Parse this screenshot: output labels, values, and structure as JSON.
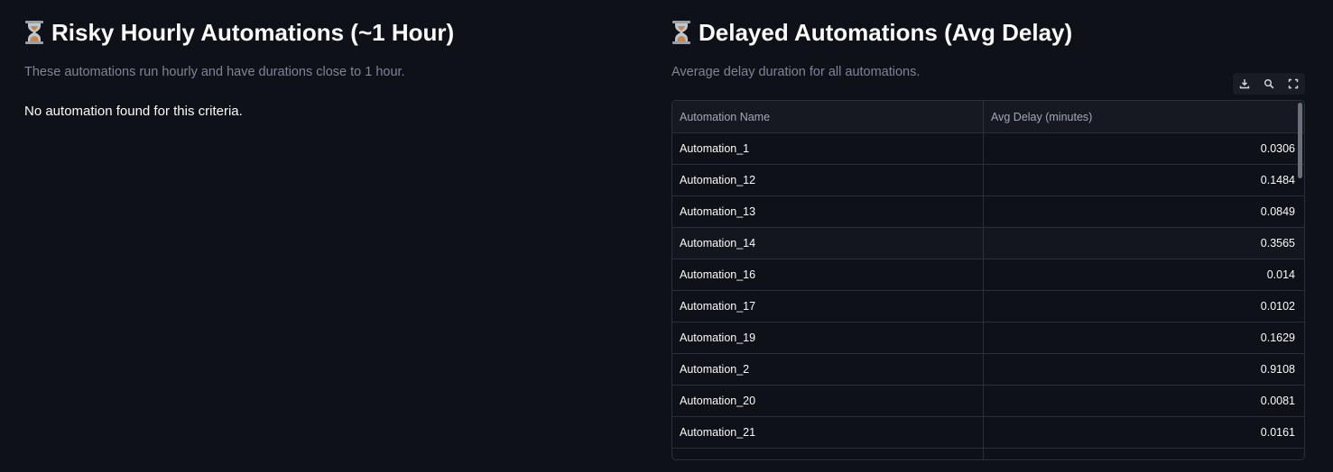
{
  "left": {
    "title": "Risky Hourly Automations (~1 Hour)",
    "caption": "These automations run hourly and have durations close to 1 hour.",
    "message": "No automation found for this criteria.",
    "icon": "hourglass-icon"
  },
  "right": {
    "title": "Delayed Automations (Avg Delay)",
    "caption": "Average delay duration for all automations.",
    "icon": "hourglass-icon",
    "toolbar": [
      "download-icon",
      "search-icon",
      "fullscreen-icon"
    ],
    "table": {
      "columns": [
        "Automation Name",
        "Avg Delay (minutes)"
      ],
      "rows": [
        {
          "name": "Automation_1",
          "value": "0.0306"
        },
        {
          "name": "Automation_12",
          "value": "0.1484"
        },
        {
          "name": "Automation_13",
          "value": "0.0849"
        },
        {
          "name": "Automation_14",
          "value": "0.3565"
        },
        {
          "name": "Automation_16",
          "value": "0.014"
        },
        {
          "name": "Automation_17",
          "value": "0.0102"
        },
        {
          "name": "Automation_19",
          "value": "0.1629"
        },
        {
          "name": "Automation_2",
          "value": "0.9108"
        },
        {
          "name": "Automation_20",
          "value": "0.0081"
        },
        {
          "name": "Automation_21",
          "value": "0.0161"
        }
      ]
    }
  },
  "colors": {
    "background": "#0e1117",
    "text": "#fafafa",
    "muted": "#808495",
    "border": "#2b2f38"
  }
}
